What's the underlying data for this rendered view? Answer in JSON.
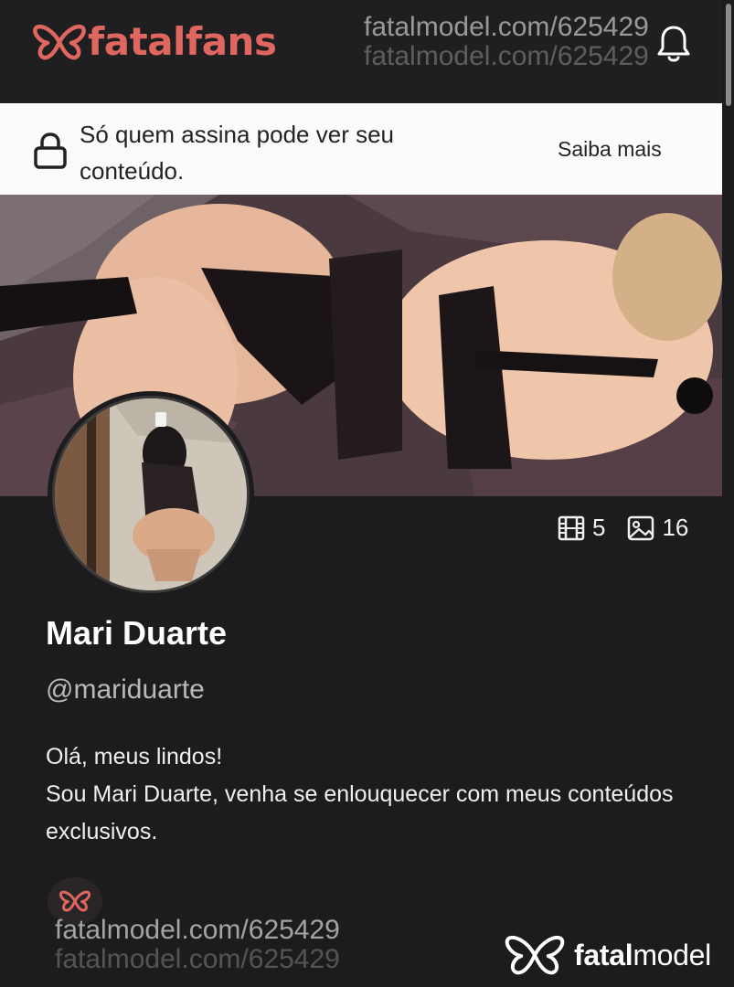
{
  "header": {
    "brand": "fatalfans",
    "watermark_line1": "fatalmodel.com/625429",
    "watermark_line2": "fatalmodel.com/625429",
    "icons": [
      "butterfly-logo-icon",
      "bell-icon"
    ],
    "brand_color": "#e0675f"
  },
  "banner": {
    "message": "Só quem assina pode ver seu conteúdo.",
    "link": "Saiba mais",
    "icon": "lock-icon"
  },
  "profile": {
    "video_count": "5",
    "image_count": "16",
    "name": "Mari Duarte",
    "handle": "@mariduarte",
    "bio_line1": "Olá, meus lindos!",
    "bio_line2": "Sou Mari Duarte, venha se enlouquecer com meus conteúdos exclusivos."
  },
  "footer": {
    "watermark_line1": "fatalmodel.com/625429",
    "watermark_line2": "fatalmodel.com/625429",
    "brand_bold": "fatal",
    "brand_regular": "model"
  }
}
